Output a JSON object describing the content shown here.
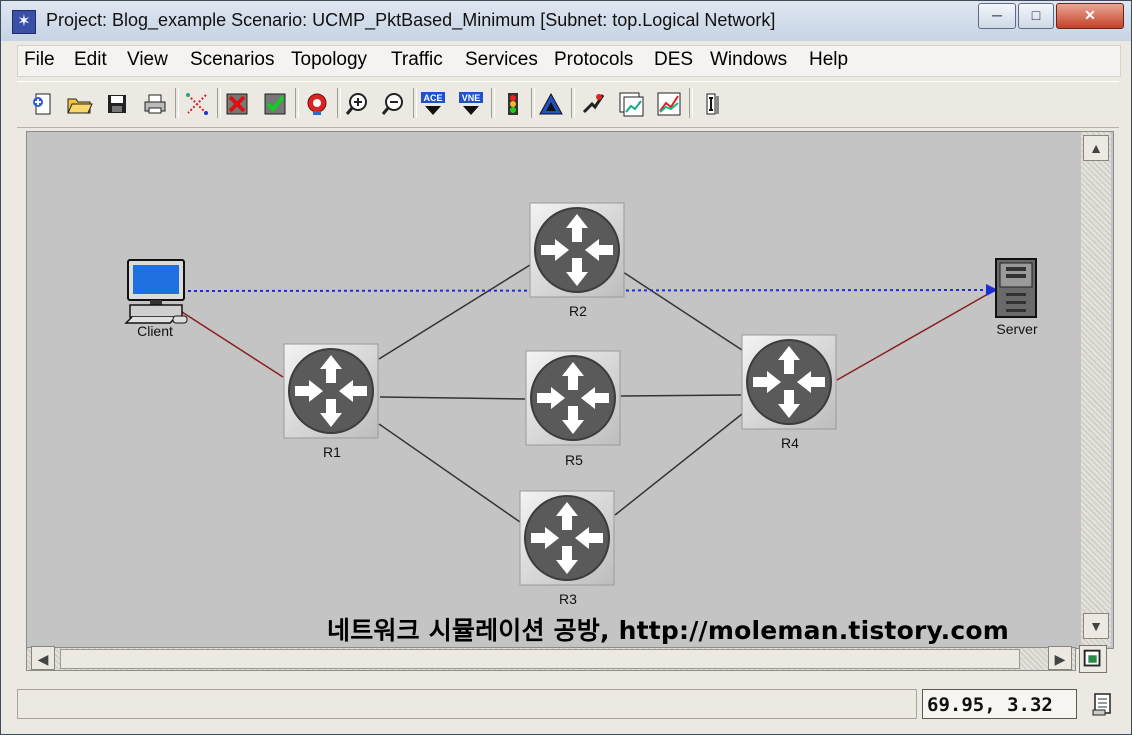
{
  "window": {
    "title": "Project: Blog_example Scenario: UCMP_PktBased_Minimum   [Subnet: top.Logical Network]",
    "minimize": "─",
    "maximize": "□",
    "close": "✕"
  },
  "menu": [
    {
      "label": "File"
    },
    {
      "label": "Edit"
    },
    {
      "label": "View"
    },
    {
      "label": "Scenarios"
    },
    {
      "label": "Topology"
    },
    {
      "label": "Traffic"
    },
    {
      "label": "Services"
    },
    {
      "label": "Protocols"
    },
    {
      "label": "DES"
    },
    {
      "label": "Windows"
    },
    {
      "label": "Help"
    }
  ],
  "toolbar": {
    "icons": [
      "new-project-icon",
      "open-folder-icon",
      "save-icon",
      "print-icon",
      "link-icon",
      "fail-node-icon",
      "verify-links-icon",
      "configure-icon",
      "zoom-in-icon",
      "zoom-out-icon",
      "ace-icon",
      "vne-icon",
      "traffic-light-icon",
      "nav-up-icon",
      "run-simulation-icon",
      "view-results-icon",
      "graph-results-icon",
      "info-icon"
    ],
    "ace_text": "ACE",
    "vne_text": "VNE"
  },
  "network": {
    "nodes": [
      {
        "id": "client",
        "label": "Client",
        "type": "workstation"
      },
      {
        "id": "r1",
        "label": "R1",
        "type": "router"
      },
      {
        "id": "r2",
        "label": "R2",
        "type": "router"
      },
      {
        "id": "r5",
        "label": "R5",
        "type": "router"
      },
      {
        "id": "r3",
        "label": "R3",
        "type": "router"
      },
      {
        "id": "r4",
        "label": "R4",
        "type": "router"
      },
      {
        "id": "server",
        "label": "Server",
        "type": "server"
      }
    ],
    "links": [
      {
        "from": "client",
        "to": "r1",
        "color": "#8b1e1e"
      },
      {
        "from": "r1",
        "to": "r2",
        "color": "#333333"
      },
      {
        "from": "r1",
        "to": "r5",
        "color": "#333333"
      },
      {
        "from": "r1",
        "to": "r3",
        "color": "#333333"
      },
      {
        "from": "r2",
        "to": "r4",
        "color": "#333333"
      },
      {
        "from": "r5",
        "to": "r4",
        "color": "#333333"
      },
      {
        "from": "r3",
        "to": "r4",
        "color": "#333333"
      },
      {
        "from": "r4",
        "to": "server",
        "color": "#8b1e1e"
      }
    ],
    "demand": {
      "from": "client",
      "to": "server",
      "color": "#1a2dd6",
      "style": "dotted"
    }
  },
  "watermark": "네트워크 시뮬레이션 공방, http://moleman.tistory.com",
  "status": {
    "coords": "69.95, 3.32"
  }
}
